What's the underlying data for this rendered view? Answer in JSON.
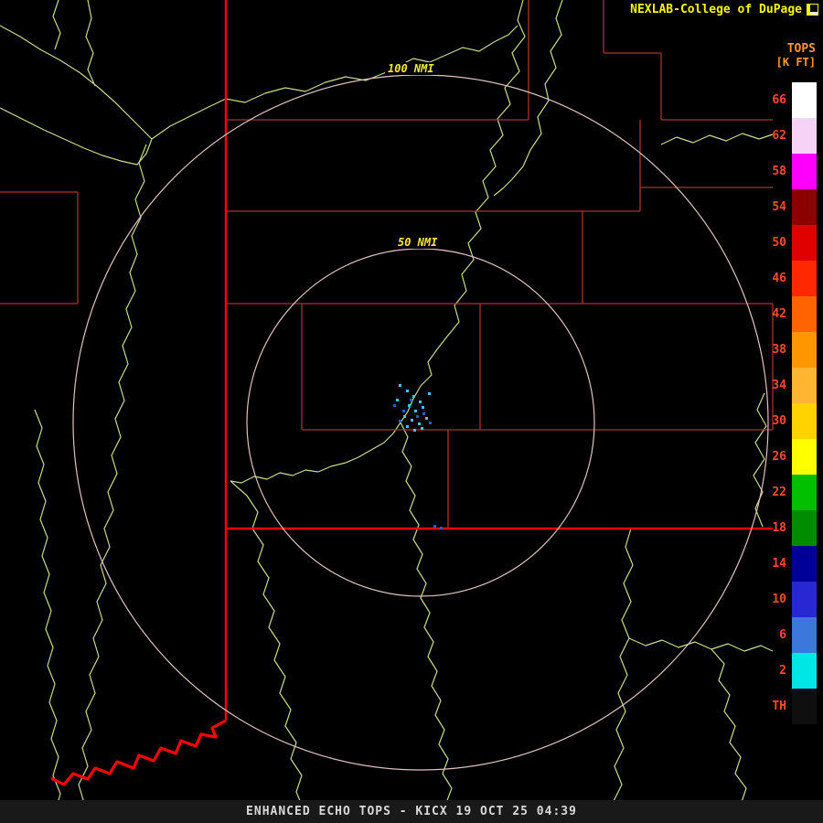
{
  "header": {
    "title": "NEXLAB-College of DuPage"
  },
  "legend": {
    "title": "TOPS",
    "units": "[K FT]",
    "bands": [
      {
        "label": "66",
        "color": "#ffffff"
      },
      {
        "label": "62",
        "color": "#f6d2f6"
      },
      {
        "label": "58",
        "color": "#fc00fc"
      },
      {
        "label": "54",
        "color": "#8c0000"
      },
      {
        "label": "50",
        "color": "#e00000"
      },
      {
        "label": "46",
        "color": "#ff2800"
      },
      {
        "label": "42",
        "color": "#ff6400"
      },
      {
        "label": "38",
        "color": "#ff9600"
      },
      {
        "label": "34",
        "color": "#ffb432"
      },
      {
        "label": "30",
        "color": "#ffd200"
      },
      {
        "label": "26",
        "color": "#ffff00"
      },
      {
        "label": "22",
        "color": "#00c000"
      },
      {
        "label": "18",
        "color": "#008c00"
      },
      {
        "label": "14",
        "color": "#000098"
      },
      {
        "label": "10",
        "color": "#2828d2"
      },
      {
        "label": "6",
        "color": "#3c78dc"
      },
      {
        "label": "2",
        "color": "#00e6e6"
      },
      {
        "label": "TH",
        "color": "#0f0f0f"
      }
    ]
  },
  "rings": {
    "outer_label": "100 NMI",
    "inner_label": "50 NMI"
  },
  "footer": {
    "caption": "ENHANCED ECHO TOPS - KICX 19 OCT 25 04:39"
  },
  "map_colors": {
    "state_border": "#fb0000",
    "county_border": "#a83430",
    "river": "#c8da8e",
    "range_ring": "#dfc2c2"
  },
  "echoes": [
    {
      "color": "#48c2ea",
      "points": [
        [
          436,
          420
        ],
        [
          444,
          426
        ],
        [
          451,
          432
        ],
        [
          458,
          438
        ],
        [
          446,
          442
        ],
        [
          453,
          448
        ],
        [
          461,
          444
        ],
        [
          441,
          454
        ],
        [
          449,
          458
        ],
        [
          457,
          462
        ],
        [
          465,
          456
        ],
        [
          444,
          465
        ],
        [
          452,
          469
        ],
        [
          460,
          467
        ],
        [
          468,
          429
        ],
        [
          433,
          436
        ]
      ]
    },
    {
      "color": "#2a5ccc",
      "points": [
        [
          448,
          436
        ],
        [
          455,
          454
        ],
        [
          440,
          448
        ],
        [
          462,
          451
        ],
        [
          436,
          459
        ],
        [
          469,
          461
        ],
        [
          474,
          574
        ],
        [
          481,
          576
        ],
        [
          430,
          442
        ]
      ]
    }
  ]
}
